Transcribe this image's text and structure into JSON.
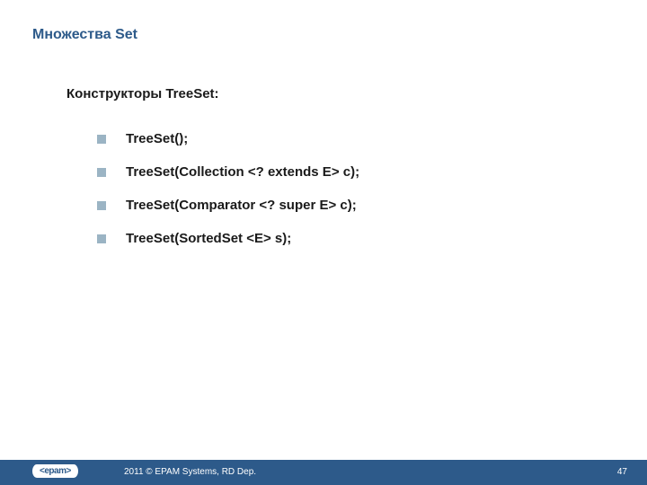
{
  "title": "Множества Set",
  "subtitle": "Конструкторы TreeSet:",
  "bullets": [
    "TreeSet();",
    "TreeSet(Collection <? extends E> c);",
    "TreeSet(Comparator <? super E> c);",
    "TreeSet(SortedSet <E> s);"
  ],
  "footer": {
    "logo_text": "<epam>",
    "copyright": "2011 © EPAM Systems, RD Dep.",
    "page_number": "47"
  },
  "colors": {
    "brand_blue": "#2d5a8a",
    "bullet": "#9bb4c4"
  }
}
